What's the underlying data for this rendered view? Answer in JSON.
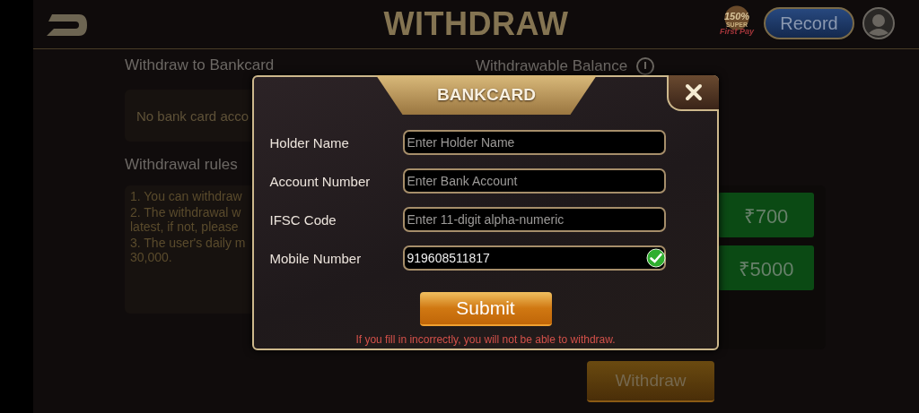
{
  "header": {
    "title": "WITHDRAW",
    "promo_badge": {
      "percent": "150%",
      "line_1": "SUPER",
      "line_2": "First Pay"
    },
    "record_button": "Record"
  },
  "page": {
    "bankcard_label": "Withdraw to Bankcard",
    "bankcard_notice": "No bank card acco",
    "balance_label": "Withdrawable Balance",
    "rules_label": "Withdrawal rules",
    "rules": [
      "1. You can withdraw",
      "2. The withdrawal w\nlatest, if not, please",
      "3. The user's daily m\n30,000."
    ],
    "amounts": [
      {
        "label": "₹700"
      },
      {
        "label": "₹5000"
      }
    ],
    "withdraw_button": "Withdraw"
  },
  "modal": {
    "title": "BANKCARD",
    "fields": [
      {
        "label": "Holder Name",
        "placeholder": "Enter Holder Name",
        "verified": false
      },
      {
        "label": "Account Number",
        "placeholder": "Enter Bank Account",
        "verified": false
      },
      {
        "label": "IFSC Code",
        "placeholder": "Enter 11-digit alpha-numeric",
        "verified": false
      },
      {
        "label": "Mobile Number",
        "value": "919608511817",
        "verified": true
      }
    ],
    "submit": "Submit",
    "warning": "If you fill in incorrectly, you will not be able to withdraw."
  }
}
